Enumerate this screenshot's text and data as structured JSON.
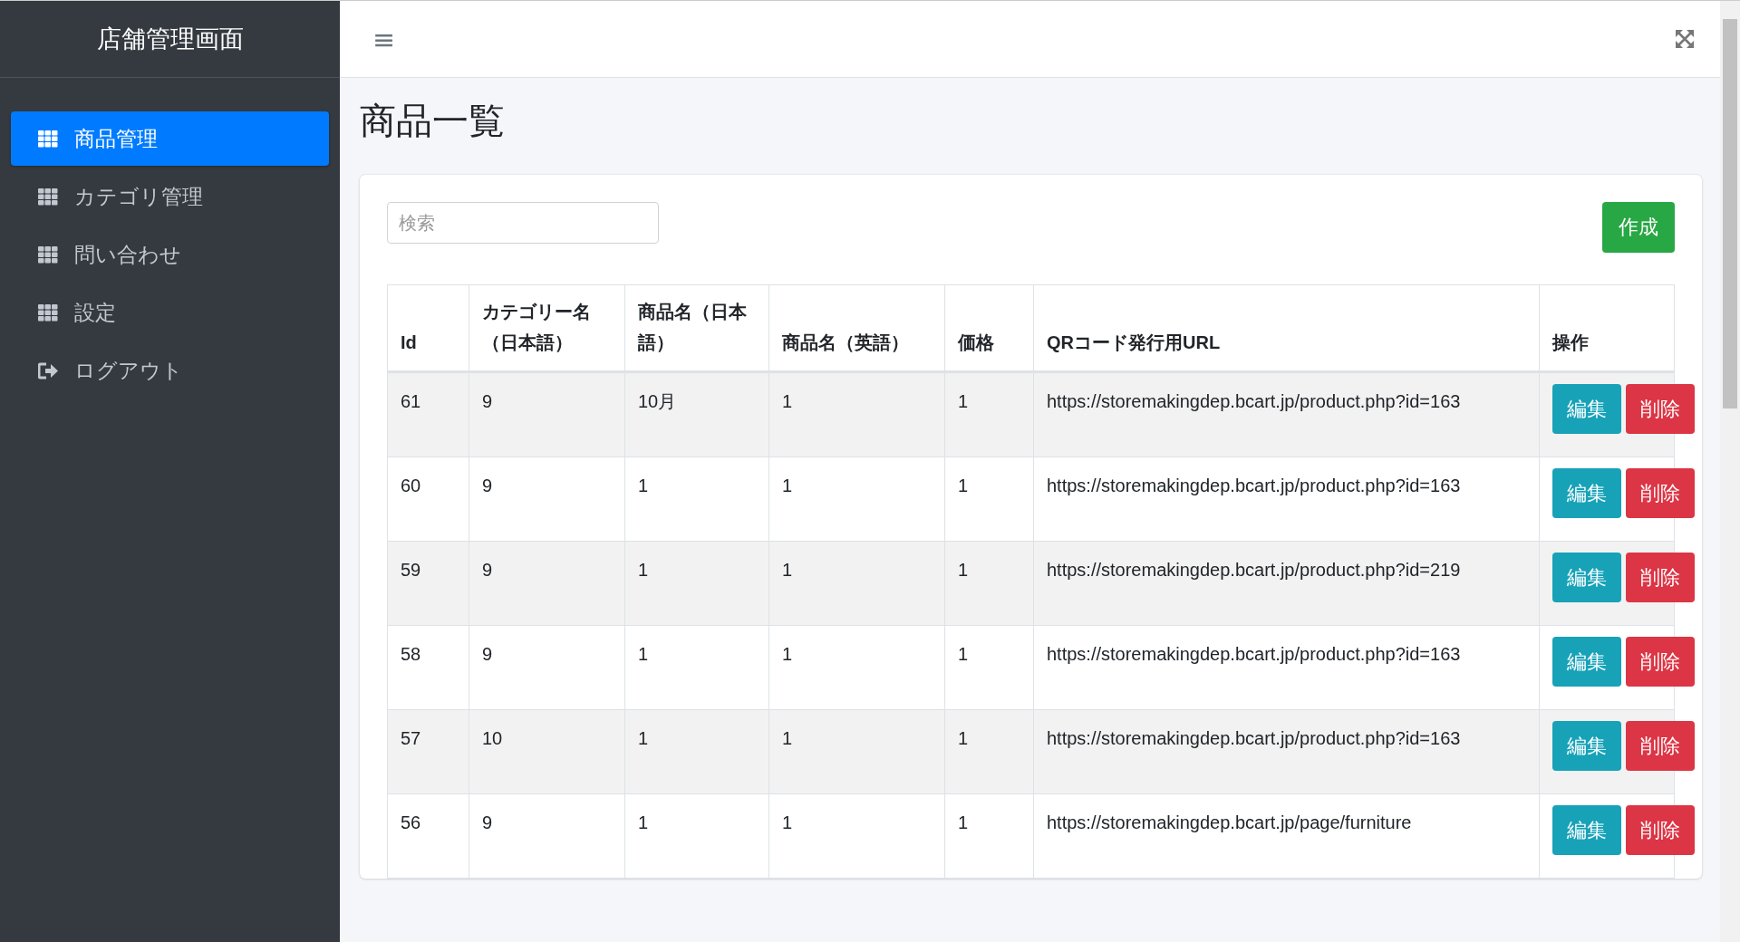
{
  "sidebar": {
    "brand": "店舗管理画面",
    "items": [
      {
        "label": "商品管理",
        "kind": "grid",
        "selected": true
      },
      {
        "label": "カテゴリ管理",
        "kind": "grid",
        "selected": false
      },
      {
        "label": "問い合わせ",
        "kind": "grid",
        "selected": false
      },
      {
        "label": "設定",
        "kind": "grid",
        "selected": false
      },
      {
        "label": "ログアウト",
        "kind": "logout",
        "selected": false
      }
    ]
  },
  "header": {
    "menu_icon": "≡"
  },
  "page_title": "商品一覧",
  "search": {
    "placeholder": "検索"
  },
  "create_button": "作成",
  "table": {
    "columns": [
      "Id",
      "カテゴリー名（日本語）",
      "商品名（日本語）",
      "商品名（英語）",
      "価格",
      "QRコード発行用URL",
      "操作"
    ],
    "rows": [
      {
        "cells": [
          "61",
          "9",
          "10月",
          "1",
          "1",
          "https://storemakingdep.bcart.jp/product.php?id=163"
        ],
        "actions": [
          "編集",
          "削除"
        ]
      },
      {
        "cells": [
          "60",
          "9",
          "1",
          "1",
          "1",
          "https://storemakingdep.bcart.jp/product.php?id=163"
        ],
        "actions": [
          "編集",
          "削除"
        ]
      },
      {
        "cells": [
          "59",
          "9",
          "1",
          "1",
          "1",
          "https://storemakingdep.bcart.jp/product.php?id=219"
        ],
        "actions": [
          "編集",
          "削除"
        ]
      },
      {
        "cells": [
          "58",
          "9",
          "1",
          "1",
          "1",
          "https://storemakingdep.bcart.jp/product.php?id=163"
        ],
        "actions": [
          "編集",
          "削除"
        ]
      },
      {
        "cells": [
          "57",
          "10",
          "1",
          "1",
          "1",
          "https://storemakingdep.bcart.jp/product.php?id=163"
        ],
        "actions": [
          "編集",
          "削除"
        ]
      },
      {
        "cells": [
          "56",
          "9",
          "1",
          "1",
          "1",
          "https://storemakingdep.bcart.jp/page/furniture"
        ],
        "actions": [
          "編集",
          "削除"
        ]
      }
    ]
  }
}
